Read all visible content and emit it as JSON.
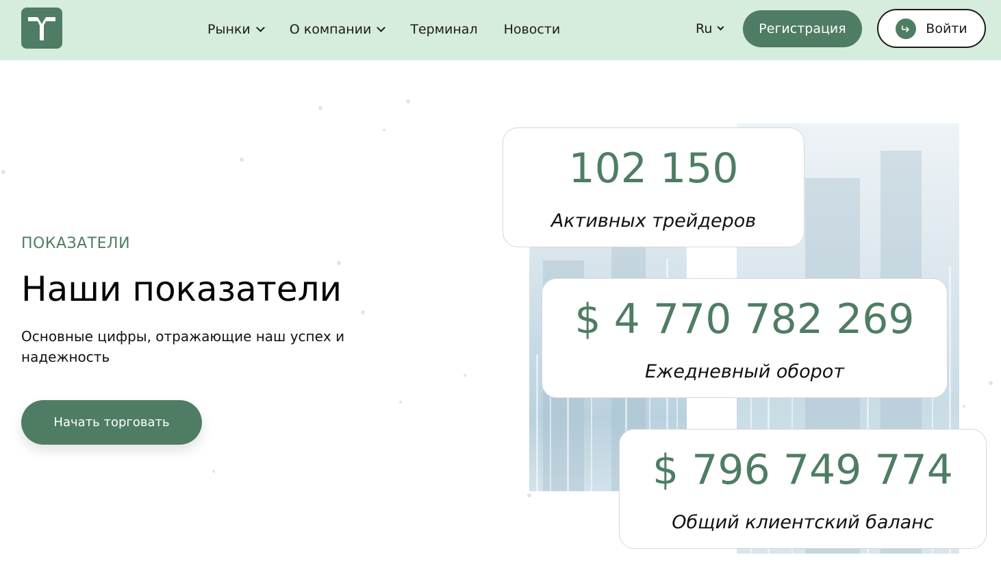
{
  "header": {
    "logo_alt": "logo-icon",
    "nav": [
      {
        "label": "Рынки",
        "has_dropdown": true
      },
      {
        "label": "О компании",
        "has_dropdown": true
      },
      {
        "label": "Терминал",
        "has_dropdown": false
      },
      {
        "label": "Новости",
        "has_dropdown": false
      }
    ],
    "language": "Ru",
    "register_label": "Регистрация",
    "login_label": "Войти"
  },
  "hero": {
    "eyebrow": "ПОКАЗАТЕЛИ",
    "title": "Наши показатели",
    "subtitle": "Основные цифры, отражающие наш успех и надежность",
    "cta_label": "Начать торговать"
  },
  "stats": [
    {
      "value": "102 150",
      "label": "Активных трейдеров"
    },
    {
      "value": "$ 4 770 782 269",
      "label": "Ежедневный оборот"
    },
    {
      "value": "$ 796 749 774",
      "label": "Общий клиентский баланс"
    }
  ],
  "colors": {
    "accent": "#4e7d63",
    "header_bg": "#d6ecdc"
  }
}
